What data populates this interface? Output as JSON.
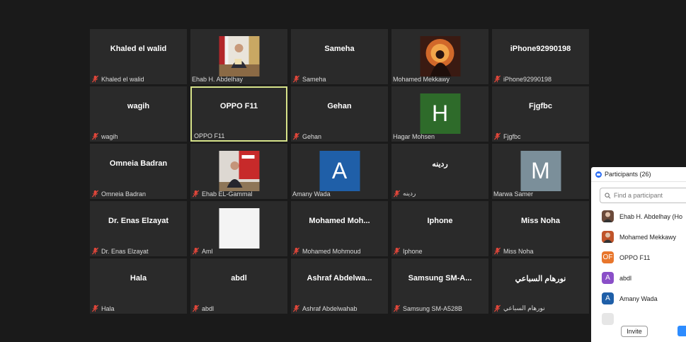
{
  "tiles": [
    {
      "center": "Khaled el walid",
      "label": "Khaled el walid"
    },
    {
      "center": "",
      "label": "Ehab H. Abdelhay",
      "photo": "man-at-desk"
    },
    {
      "center": "Sameha",
      "label": "Sameha"
    },
    {
      "center": "",
      "label": "Mohamed Mekkawy",
      "photo": "sunset-figure"
    },
    {
      "center": "iPhone92990198",
      "label": "iPhone92990198"
    },
    {
      "center": "wagih",
      "label": "wagih"
    },
    {
      "center": "OPPO F11",
      "label": "OPPO F11",
      "active": true
    },
    {
      "center": "Gehan",
      "label": "Gehan"
    },
    {
      "center": "",
      "label": "Hagar Mohsen",
      "avatar": "H",
      "avatar_color": "#2e6b2a"
    },
    {
      "center": "Fjgfbc",
      "label": "Fjgfbc"
    },
    {
      "center": "Omneia Badran",
      "label": "Omneia Badran"
    },
    {
      "center": "",
      "label": "Ehab EL-Gammal",
      "photo": "man-red-backdrop"
    },
    {
      "center": "",
      "label": "Amany Wada",
      "avatar": "A",
      "avatar_color": "#1f5fa8"
    },
    {
      "center": "ردينه",
      "label": "ردينه"
    },
    {
      "center": "",
      "label": "Marwa Samer",
      "avatar": "M",
      "avatar_color": "#7b8f9a"
    },
    {
      "center": "Dr. Enas Elzayat",
      "label": "Dr. Enas Elzayat"
    },
    {
      "center": "",
      "label": "Aml",
      "photo": "blank-white"
    },
    {
      "center": "Mohamed  Moh...",
      "label": "Mohamed Mohmoud"
    },
    {
      "center": "Iphone",
      "label": "Iphone"
    },
    {
      "center": "Miss Noha",
      "label": "Miss Noha"
    },
    {
      "center": "Hala",
      "label": "Hala"
    },
    {
      "center": "abdl",
      "label": "abdl"
    },
    {
      "center": "Ashraf  Abdelwa...",
      "label": "Ashraf Abdelwahab"
    },
    {
      "center": "Samsung  SM-A...",
      "label": "Samsung SM-A528B"
    },
    {
      "center": "نورهام السباعي",
      "label": "نورهام السباعي"
    }
  ],
  "panel": {
    "title": "Participants (26)",
    "search_placeholder": "Find a participant",
    "participants": [
      {
        "name": "Ehab H. Abdelhay (Ho",
        "avatar": "photo",
        "color": "#6b4a3a"
      },
      {
        "name": "Mohamed Mekkawy",
        "avatar": "photo",
        "color": "#c0542a"
      },
      {
        "name": "OPPO F11",
        "avatar": "OF",
        "color": "#e8762c"
      },
      {
        "name": "abdl",
        "avatar": "A",
        "color": "#8a4fc8"
      },
      {
        "name": "Amany Wada",
        "avatar": "A",
        "color": "#1f5fa8"
      },
      {
        "name": "",
        "avatar": "",
        "color": "#e6e6e6"
      }
    ],
    "invite_label": "Invite"
  },
  "colors": {
    "tile_bg": "#2a2a2a",
    "active_border": "#d6e28a",
    "mute_icon": "#e0463a"
  }
}
